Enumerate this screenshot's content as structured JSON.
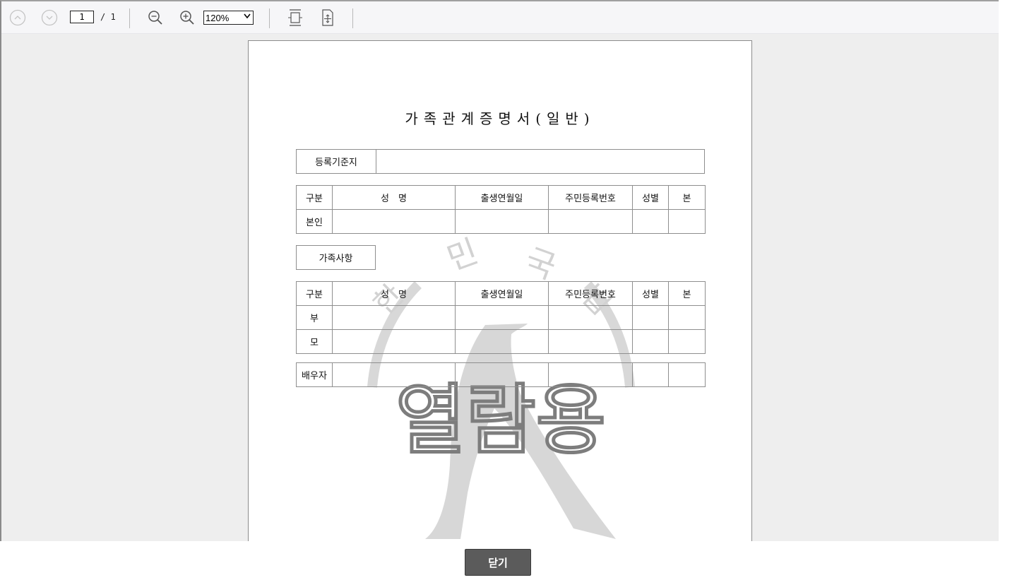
{
  "toolbar": {
    "page_current": "1",
    "page_total": "/ 1",
    "zoom_value": "120%",
    "zoom_options": [
      "120%"
    ],
    "icons": [
      "chevron-up-icon",
      "chevron-down-icon",
      "zoom-out-icon",
      "zoom-in-icon",
      "fit-width-icon",
      "fit-page-icon"
    ]
  },
  "document": {
    "title": "가족관계증명서(일반)",
    "registry_label": "등록기준지",
    "registry_value": "",
    "headers": {
      "category": "구분",
      "name": "성　명",
      "birth": "출생연월일",
      "resident_no": "주민등록번호",
      "sex": "성별",
      "clan": "본"
    },
    "self_row_label": "본인",
    "family_section_label": "가족사항",
    "family_rows": [
      "부",
      "모"
    ],
    "spouse_label": "배우자",
    "watermark_text": "열람용",
    "seal_text": "대 한 민 국 법 원"
  },
  "footer": {
    "close_label": "닫기"
  },
  "colors": {
    "button_bg": "#5b5b5b",
    "toolbar_bg": "#f6f6f8",
    "viewer_bg": "#eeeeee",
    "watermark": "#d6d6d6"
  }
}
